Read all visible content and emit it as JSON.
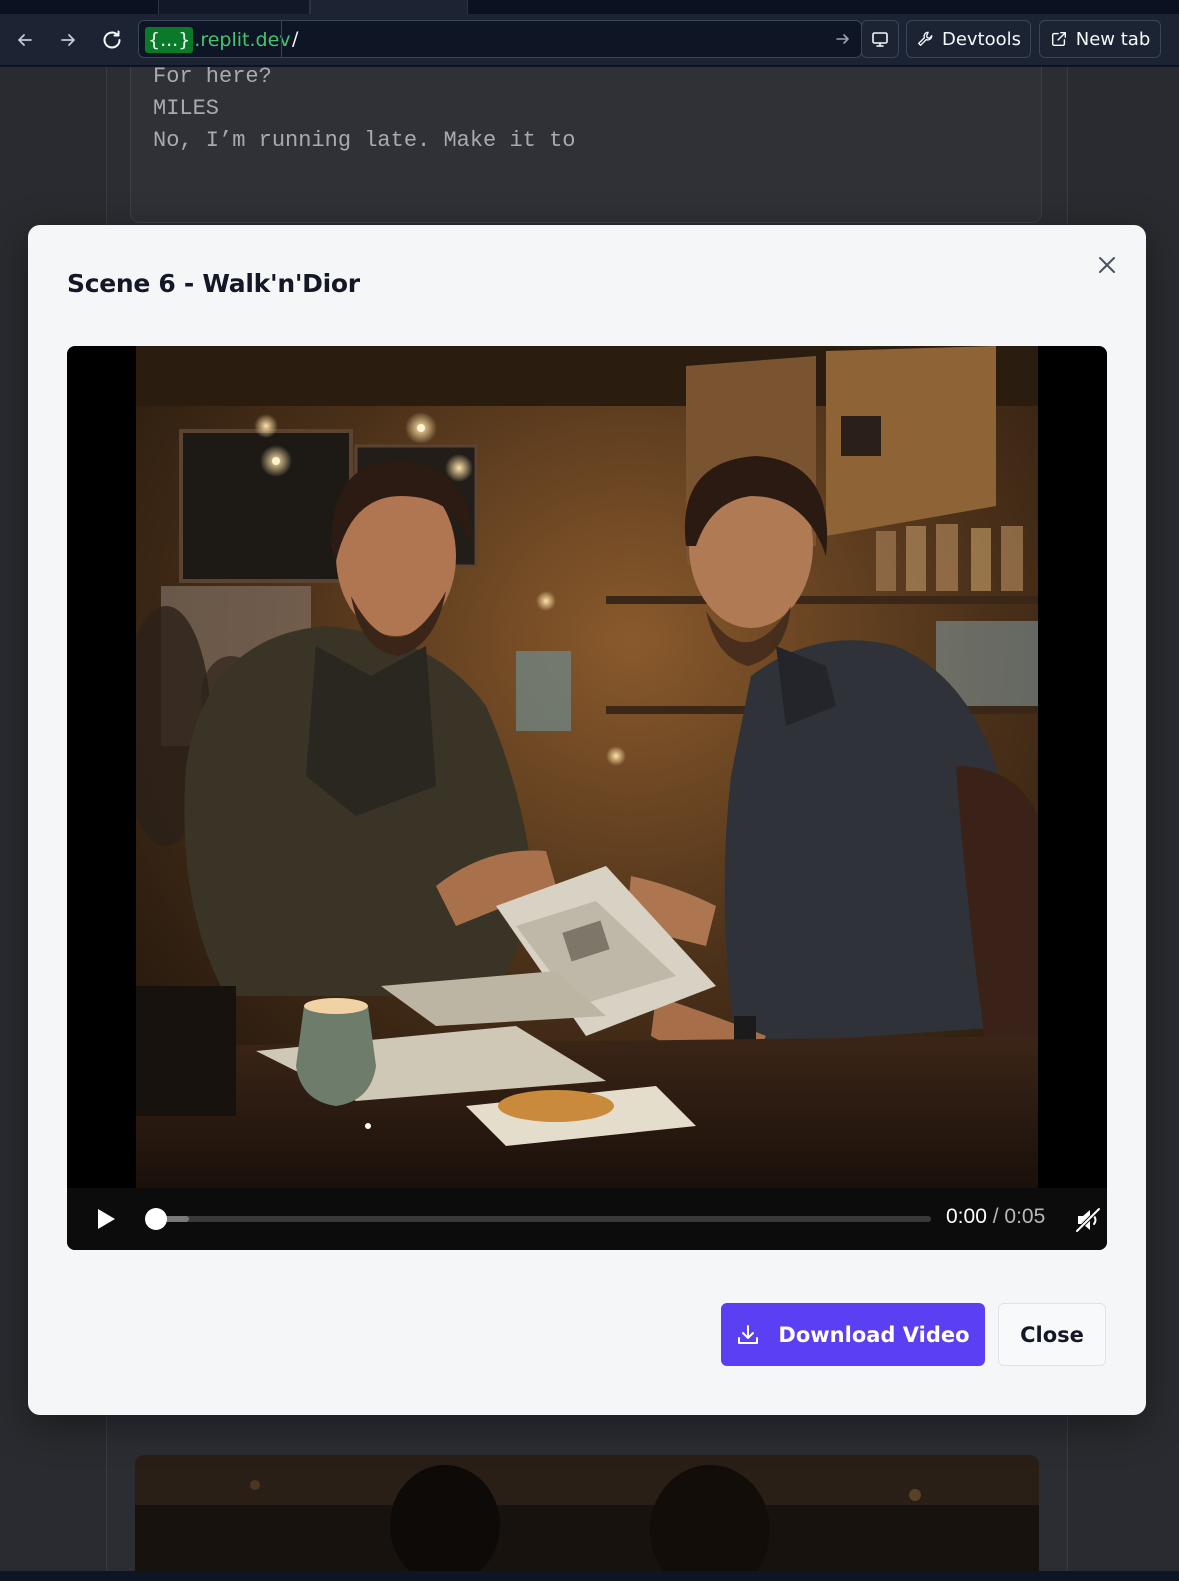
{
  "browser": {
    "url_host_badge": "{...}",
    "url_host_rest": ".replit.dev",
    "url_path": "/",
    "devtools_label": "Devtools",
    "new_tab_label": "New tab"
  },
  "background": {
    "script_lines": [
      "For here?",
      "MILES",
      "No, I’m running late. Make it to"
    ]
  },
  "modal": {
    "title": "Scene 6 - Walk'n'Dior",
    "player": {
      "current_time": "0:00",
      "separator": " / ",
      "duration": "0:05",
      "progress": 0.0,
      "muted": true
    },
    "download_label": "Download Video",
    "close_label": "Close"
  },
  "icons": {
    "back": "arrow-left-icon",
    "forward": "arrow-right-icon",
    "reload": "reload-icon",
    "go": "arrow-right-icon",
    "screen": "monitor-icon",
    "devtools": "wrench-icon",
    "new_tab": "external-link-icon",
    "close": "close-icon",
    "play": "play-icon",
    "mute": "volume-muted-icon",
    "fullscreen": "fullscreen-icon",
    "download": "download-icon"
  },
  "colors": {
    "accent": "#5b3ff2",
    "url_host": "#46c46e",
    "modal_bg": "#f5f6f8",
    "chrome_bg": "#1c2333"
  }
}
